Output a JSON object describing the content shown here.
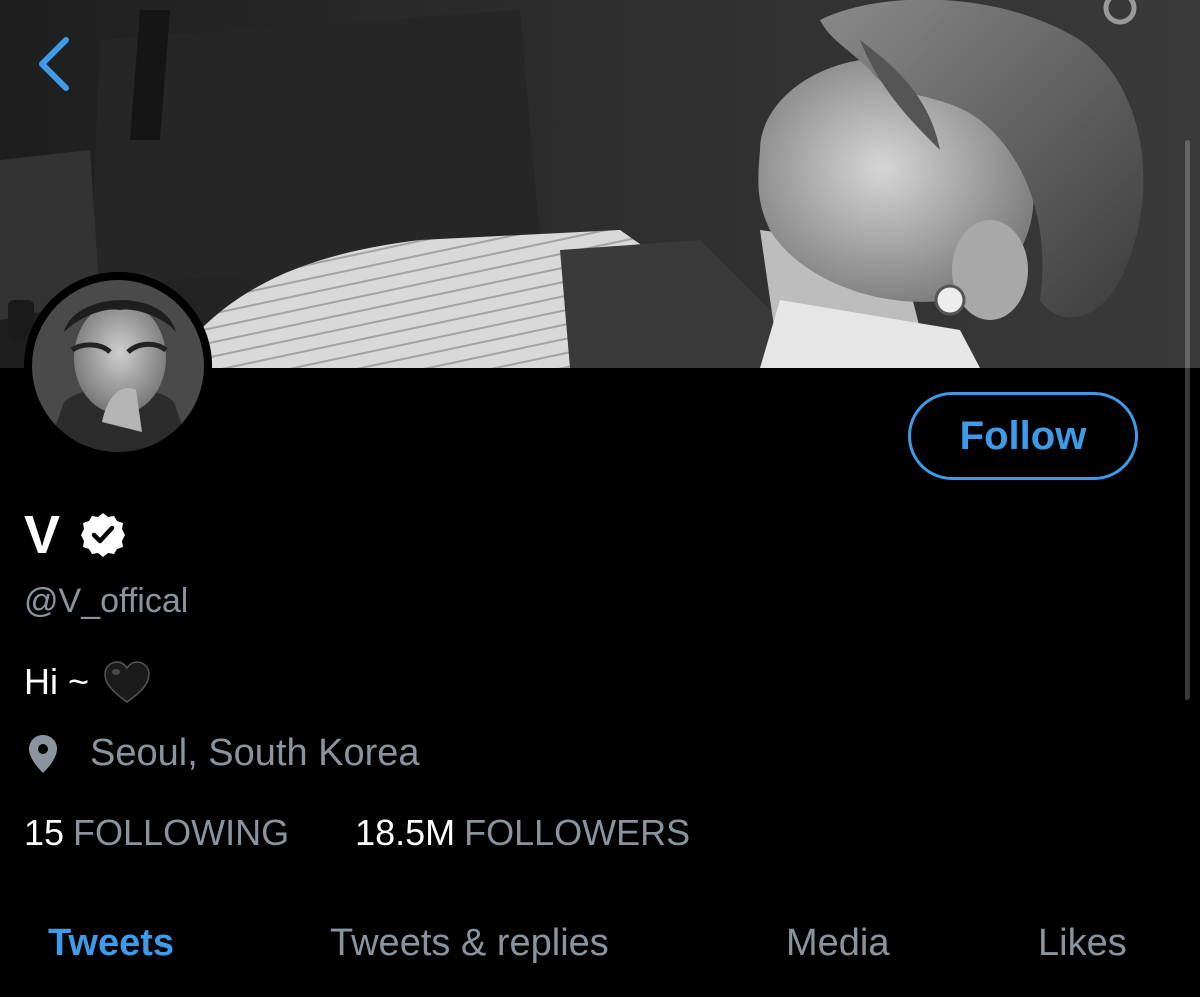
{
  "header": {
    "back_icon": "chevron-left-icon"
  },
  "profile": {
    "display_name": "V",
    "verified_icon": "verified-badge-icon",
    "handle": "@V_offical",
    "bio_text": "Hi ~",
    "bio_emoji_icon": "black-heart-icon",
    "location_icon": "location-pin-icon",
    "location": "Seoul, South Korea",
    "follow_label": "Follow"
  },
  "stats": {
    "following_count": "15",
    "following_label": "FOLLOWING",
    "followers_count": "18.5M",
    "followers_label": "FOLLOWERS"
  },
  "tabs": [
    {
      "label": "Tweets",
      "active": true
    },
    {
      "label": "Tweets & replies",
      "active": false
    },
    {
      "label": "Media",
      "active": false
    },
    {
      "label": "Likes",
      "active": false
    }
  ],
  "colors": {
    "background": "#000000",
    "accent": "#3d9be9",
    "secondary_text": "#8a949f",
    "primary_text": "#ffffff"
  }
}
